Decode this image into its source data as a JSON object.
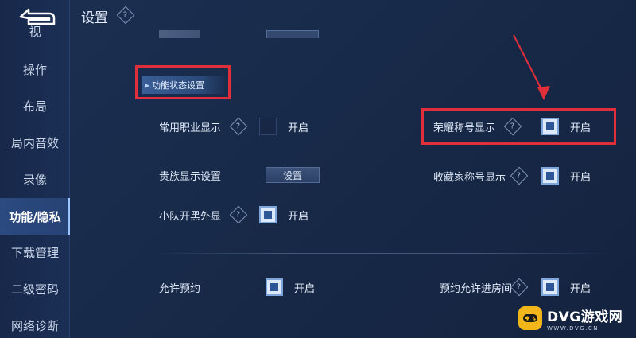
{
  "header": {
    "title": "设置"
  },
  "sidebar": {
    "items": [
      {
        "label": "视"
      },
      {
        "label": "操作"
      },
      {
        "label": "布局"
      },
      {
        "label": "局内音效"
      },
      {
        "label": "录像"
      },
      {
        "label": "功能/隐私"
      },
      {
        "label": "下载管理"
      },
      {
        "label": "二级密码"
      },
      {
        "label": "网络诊断"
      }
    ]
  },
  "section": {
    "title": "功能状态设置"
  },
  "settings": {
    "common_job": {
      "label": "常用职业显示",
      "status": "开启",
      "checked": false
    },
    "honor_title": {
      "label": "荣耀称号显示",
      "status": "开启",
      "checked": true
    },
    "noble": {
      "label": "贵族显示设置",
      "button": "设置"
    },
    "collector": {
      "label": "收藏家称号显示",
      "status": "开启",
      "checked": true
    },
    "team_black": {
      "label": "小队开黑外显",
      "status": "开启",
      "checked": true
    },
    "allow_reserve": {
      "label": "允许预约",
      "status": "开启",
      "checked": true
    },
    "reserve_room": {
      "label": "预约允许进房间",
      "status": "开启",
      "checked": true
    }
  },
  "watermark": {
    "brand": "DVG游戏网",
    "url": "WWW.DVG.CN"
  },
  "colors": {
    "highlight": "#e02f3a",
    "accent": "#2d5696",
    "logo": "#f2b51a"
  }
}
